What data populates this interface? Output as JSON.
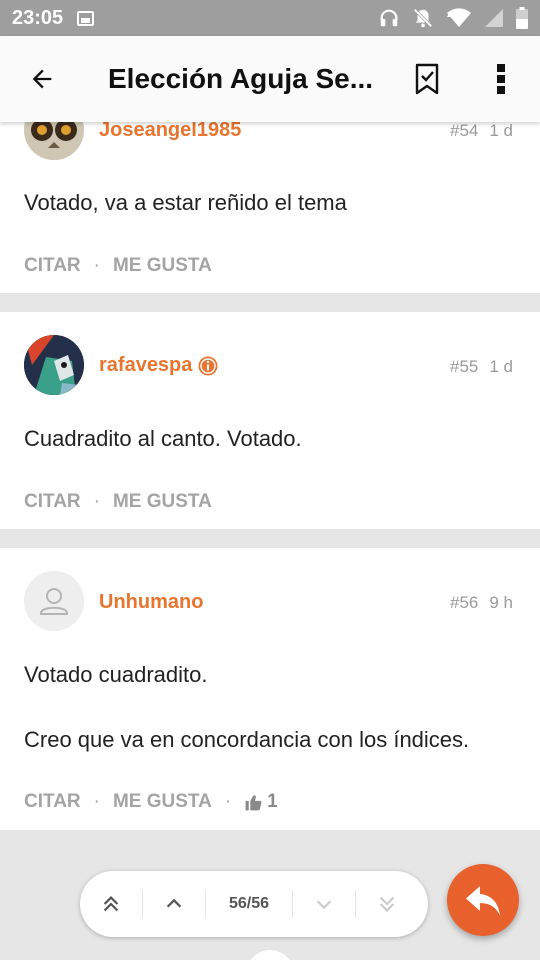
{
  "status_bar": {
    "time": "23:05",
    "icons": [
      "image-icon",
      "headphones-icon",
      "notifications-off-icon",
      "wifi-icon",
      "signal-icon",
      "battery-icon"
    ]
  },
  "app_bar": {
    "title": "Elección Aguja Se...",
    "icons": [
      "back-arrow-icon",
      "bookmark-check-icon",
      "more-vert-icon"
    ]
  },
  "posts": [
    {
      "username": "Joseangel1985",
      "number": "#54",
      "age": "1 d",
      "paragraphs": [
        "Votado, va a estar reñido el tema"
      ],
      "actions": {
        "quote": "CITAR",
        "like": "ME GUSTA"
      }
    },
    {
      "username": "rafavespa",
      "number": "#55",
      "age": "1 d",
      "badge": "info-badge-icon",
      "paragraphs": [
        "Cuadradito al canto. Votado."
      ],
      "actions": {
        "quote": "CITAR",
        "like": "ME GUSTA"
      }
    },
    {
      "username": "Unhumano",
      "number": "#56",
      "age": "9 h",
      "paragraphs": [
        "Votado cuadradito.",
        "Creo que va en concordancia con los índices."
      ],
      "actions": {
        "quote": "CITAR",
        "like": "ME GUSTA",
        "likes_count": "1"
      }
    }
  ],
  "pager": {
    "position": "56/56",
    "icons": [
      "double-chevron-up-icon",
      "chevron-up-icon",
      "chevron-down-icon",
      "double-chevron-down-icon"
    ]
  },
  "fab": {
    "icon": "reply-icon"
  },
  "colors": {
    "accent": "#e8752f",
    "fab": "#e8612c",
    "status_bar": "#9e9e9e",
    "muted": "#a4a4a4"
  }
}
